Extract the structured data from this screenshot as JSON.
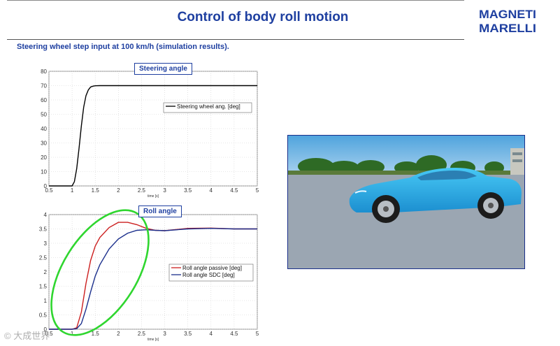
{
  "header": {
    "title": "Control of body roll motion",
    "subtitle": "Steering wheel step input at 100 km/h (simulation results).",
    "logo_text": [
      "MAGNETI",
      "MARELLI"
    ],
    "accent_color": "#1e3fa0"
  },
  "watermark": "© 大成世界",
  "chart_data": [
    {
      "type": "line",
      "title": "Steering angle",
      "xlabel": "time [s]",
      "ylabel": "",
      "xlim": [
        0.5,
        5
      ],
      "ylim": [
        0,
        80
      ],
      "xticks": [
        "0.5",
        "1",
        "1.5",
        "2",
        "2.5",
        "3",
        "3.5",
        "4",
        "4.5",
        "5"
      ],
      "yticks": [
        "0",
        "10",
        "20",
        "30",
        "40",
        "50",
        "60",
        "70",
        "80"
      ],
      "grid": true,
      "legend_position": "right",
      "series": [
        {
          "name": "Steering wheel ang. [deg]",
          "color": "#000000",
          "x": [
            0.5,
            1.0,
            1.05,
            1.1,
            1.15,
            1.2,
            1.25,
            1.3,
            1.35,
            1.4,
            1.45,
            1.5,
            1.6,
            2.0,
            5.0
          ],
          "y": [
            0,
            0,
            3,
            12,
            26,
            42,
            55,
            63,
            67,
            69,
            69.6,
            69.9,
            70,
            70,
            70
          ]
        }
      ]
    },
    {
      "type": "line",
      "title": "Roll angle",
      "xlabel": "time [s]",
      "ylabel": "",
      "xlim": [
        0.5,
        5
      ],
      "ylim": [
        0,
        4
      ],
      "xticks": [
        "0.5",
        "1",
        "1.5",
        "2",
        "2.5",
        "3",
        "3.5",
        "4",
        "4.5",
        "5"
      ],
      "yticks": [
        "0",
        "0.5",
        "1",
        "1.5",
        "2",
        "2.5",
        "3",
        "3.5",
        "4"
      ],
      "grid": true,
      "legend_position": "right",
      "annotation": "green ellipse highlighting the transient (0.6 s to 2.7 s)",
      "series": [
        {
          "name": "Roll angle passive [deg]",
          "color": "#cc1f1f",
          "x": [
            0.5,
            1.0,
            1.1,
            1.2,
            1.3,
            1.4,
            1.5,
            1.6,
            1.8,
            2.0,
            2.2,
            2.4,
            2.6,
            2.8,
            3.0,
            3.5,
            4.0,
            4.5,
            5.0
          ],
          "y": [
            0,
            0,
            0.05,
            0.6,
            1.6,
            2.4,
            2.9,
            3.2,
            3.55,
            3.73,
            3.73,
            3.65,
            3.52,
            3.45,
            3.44,
            3.52,
            3.53,
            3.5,
            3.5
          ]
        },
        {
          "name": "Roll angle SDC [deg]",
          "color": "#1b2f8c",
          "x": [
            0.5,
            1.0,
            1.1,
            1.2,
            1.3,
            1.4,
            1.5,
            1.6,
            1.8,
            2.0,
            2.2,
            2.4,
            2.6,
            2.8,
            3.0,
            3.5,
            4.0,
            4.5,
            5.0
          ],
          "y": [
            0,
            0,
            0.02,
            0.2,
            0.7,
            1.3,
            1.85,
            2.25,
            2.8,
            3.15,
            3.35,
            3.45,
            3.47,
            3.45,
            3.44,
            3.5,
            3.52,
            3.5,
            3.5
          ]
        }
      ]
    }
  ]
}
